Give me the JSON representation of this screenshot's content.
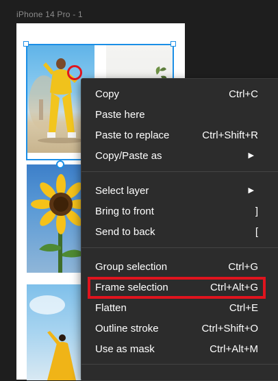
{
  "canvas": {
    "frame_label": "iPhone 14 Pro - 1"
  },
  "context_menu": {
    "groups": [
      [
        {
          "label": "Copy",
          "shortcut": "Ctrl+C"
        },
        {
          "label": "Paste here",
          "shortcut": ""
        },
        {
          "label": "Paste to replace",
          "shortcut": "Ctrl+Shift+R"
        },
        {
          "label": "Copy/Paste as",
          "submenu": true
        }
      ],
      [
        {
          "label": "Select layer",
          "submenu": true
        },
        {
          "label": "Bring to front",
          "shortcut": "]"
        },
        {
          "label": "Send to back",
          "shortcut": "["
        }
      ],
      [
        {
          "label": "Group selection",
          "shortcut": "Ctrl+G"
        },
        {
          "label": "Frame selection",
          "shortcut": "Ctrl+Alt+G",
          "highlighted": true
        },
        {
          "label": "Flatten",
          "shortcut": "Ctrl+E"
        },
        {
          "label": "Outline stroke",
          "shortcut": "Ctrl+Shift+O"
        },
        {
          "label": "Use as mask",
          "shortcut": "Ctrl+Alt+M"
        }
      ]
    ]
  },
  "colors": {
    "selection": "#1a8ee6",
    "annotation": "#e0141e",
    "menu_bg": "#2c2c2c",
    "canvas_bg": "#1e1e1e"
  }
}
